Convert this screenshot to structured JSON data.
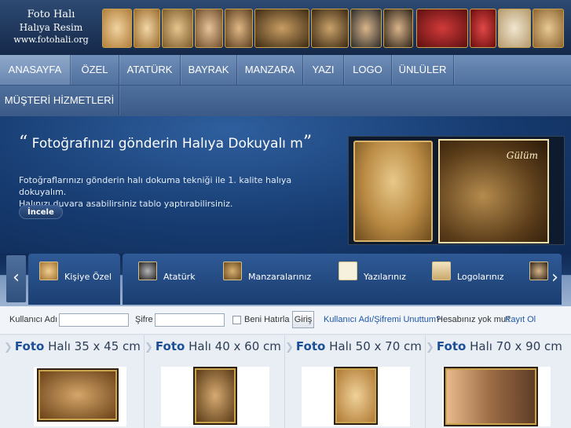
{
  "logo": {
    "line1": "Foto Halı",
    "line2": "Halıya Resim",
    "line3": "www.fotohali.org"
  },
  "nav": {
    "items": [
      "ANASAYFA",
      "ÖZEL",
      "ATATÜRK",
      "BAYRAK",
      "MANZARA",
      "YAZI",
      "LOGO",
      "ÜNLÜLER",
      "MÜŞTERİ HİZMETLERİ"
    ],
    "active": "ANASAYFA"
  },
  "hero": {
    "quote_open": "“",
    "quote_close": "”",
    "title": "Fotoğrafınızı gönderin Halıya Dokuyalı m",
    "line1": "Fotoğraflarınızı gönderin halı dokuma tekniği ile 1. kalite halıya dokuyalım.",
    "line2": "Halınızı duvara asabilirsiniz tablo yaptırabilirsiniz.",
    "button": "İncele",
    "image_caption": "Gülüm"
  },
  "carousel": {
    "prev": "‹",
    "next": "›",
    "categories": [
      "Kişiye Özel",
      "Atatürk",
      "Manzaralarınız",
      "Yazılarınız",
      "Logolarınız"
    ]
  },
  "login": {
    "username_label": "Kullanıcı Adı",
    "password_label": "Şifre",
    "remember_label": "Beni Hatırla",
    "submit": "Giriş",
    "forgot_link": "Kullanıcı Adı/Şifremi Unuttum?",
    "no_account": "Hesabınız yok mu?",
    "register_link": "Kayıt Ol"
  },
  "products": [
    {
      "w1": "Foto",
      "w2": "Halı 35 x 45 cm"
    },
    {
      "w1": "Foto",
      "w2": "Halı 40 x 60 cm"
    },
    {
      "w1": "Foto",
      "w2": "Halı 50 x 70 cm"
    },
    {
      "w1": "Foto",
      "w2": "Halı 70 x 90 cm"
    }
  ],
  "colors": {
    "brand_dark": "#15294a",
    "nav": "#4f6f9d",
    "link": "#1d57a8",
    "gold": "#c9a24b"
  }
}
